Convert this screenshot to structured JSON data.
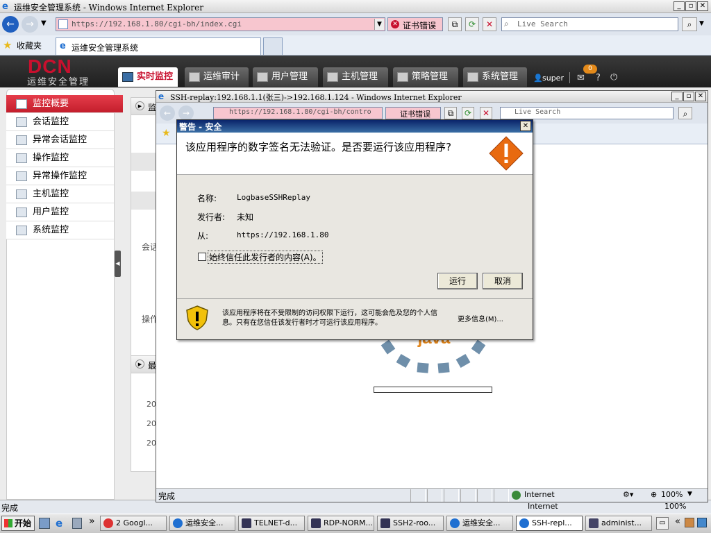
{
  "main_window": {
    "title": "运维安全管理系统 - Windows Internet Explorer",
    "url": "https://192.168.1.80/cgi-bh/index.cgi",
    "cert_error": "证书错误",
    "search_placeholder": "Live Search",
    "favorites_label": "收藏夹",
    "tab_title": "运维安全管理系统",
    "status": "完成"
  },
  "app": {
    "logo_text": "DCN",
    "logo_subtitle": "运维安全管理",
    "nav_tabs": [
      {
        "label": "实时监控",
        "active": true
      },
      {
        "label": "运维审计"
      },
      {
        "label": "用户管理"
      },
      {
        "label": "主机管理"
      },
      {
        "label": "策略管理"
      },
      {
        "label": "系统管理"
      }
    ],
    "user": "super",
    "message_count": "0",
    "help": "?",
    "sidebar": [
      {
        "label": "监控概要",
        "active": true
      },
      {
        "label": "会话监控"
      },
      {
        "label": "异常会话监控"
      },
      {
        "label": "操作监控"
      },
      {
        "label": "异常操作监控"
      },
      {
        "label": "主机监控"
      },
      {
        "label": "用户监控"
      },
      {
        "label": "系统监控"
      }
    ],
    "content_fragments": {
      "section1": "监",
      "row_session": "会话",
      "row_operation": "操作",
      "section2": "最",
      "year1": "20",
      "year2": "20",
      "year3": "20"
    }
  },
  "popup_window": {
    "title": "SSH-replay:192.168.1.1(张三)->192.168.1.124 - Windows Internet Explorer",
    "url": "https://192.168.1.80/cgi-bh/contro",
    "cert_error": "证书错误",
    "search_placeholder": "Live Search",
    "java_text": "java",
    "status": "完成",
    "zone": "Internet",
    "zoom": "100%"
  },
  "dialog": {
    "title": "警告 - 安全",
    "question": "该应用程序的数字签名无法验证。是否要运行该应用程序?",
    "name_label": "名称:",
    "name_value": "LogbaseSSHReplay",
    "publisher_label": "发行者:",
    "publisher_value": "未知",
    "from_label": "从:",
    "from_value": "https://192.168.1.80",
    "checkbox_label": "始终信任此发行者的内容(A)。",
    "checkbox_checked": false,
    "run_button": "运行",
    "cancel_button": "取消",
    "warning_text": "该应用程序将在不受限制的访问权限下运行，这可能会危及您的个人信息。只有在您信任该发行者时才可运行该应用程序。",
    "more_info": "更多信息(M)..."
  },
  "status_bar_bg": {
    "zone": "Internet",
    "zoom": "100%"
  },
  "taskbar": {
    "start_label": "开始",
    "chevron": "»",
    "items": [
      {
        "label": "2 Googl...",
        "active": false
      },
      {
        "label": "运维安全...",
        "active": false
      },
      {
        "label": "TELNET-d...",
        "active": false
      },
      {
        "label": "RDP-NORM...",
        "active": false
      },
      {
        "label": "SSH2-roo...",
        "active": false
      },
      {
        "label": "运维安全...",
        "active": false
      },
      {
        "label": "SSH-repl...",
        "active": true
      },
      {
        "label": "administ...",
        "active": false
      }
    ]
  },
  "colors": {
    "accent_red": "#c8102e",
    "dialog_title_blue": "#0a246a",
    "cert_error_pink": "#f7c6cf",
    "java_blue": "#6f8faa",
    "java_orange": "#e4861a"
  }
}
